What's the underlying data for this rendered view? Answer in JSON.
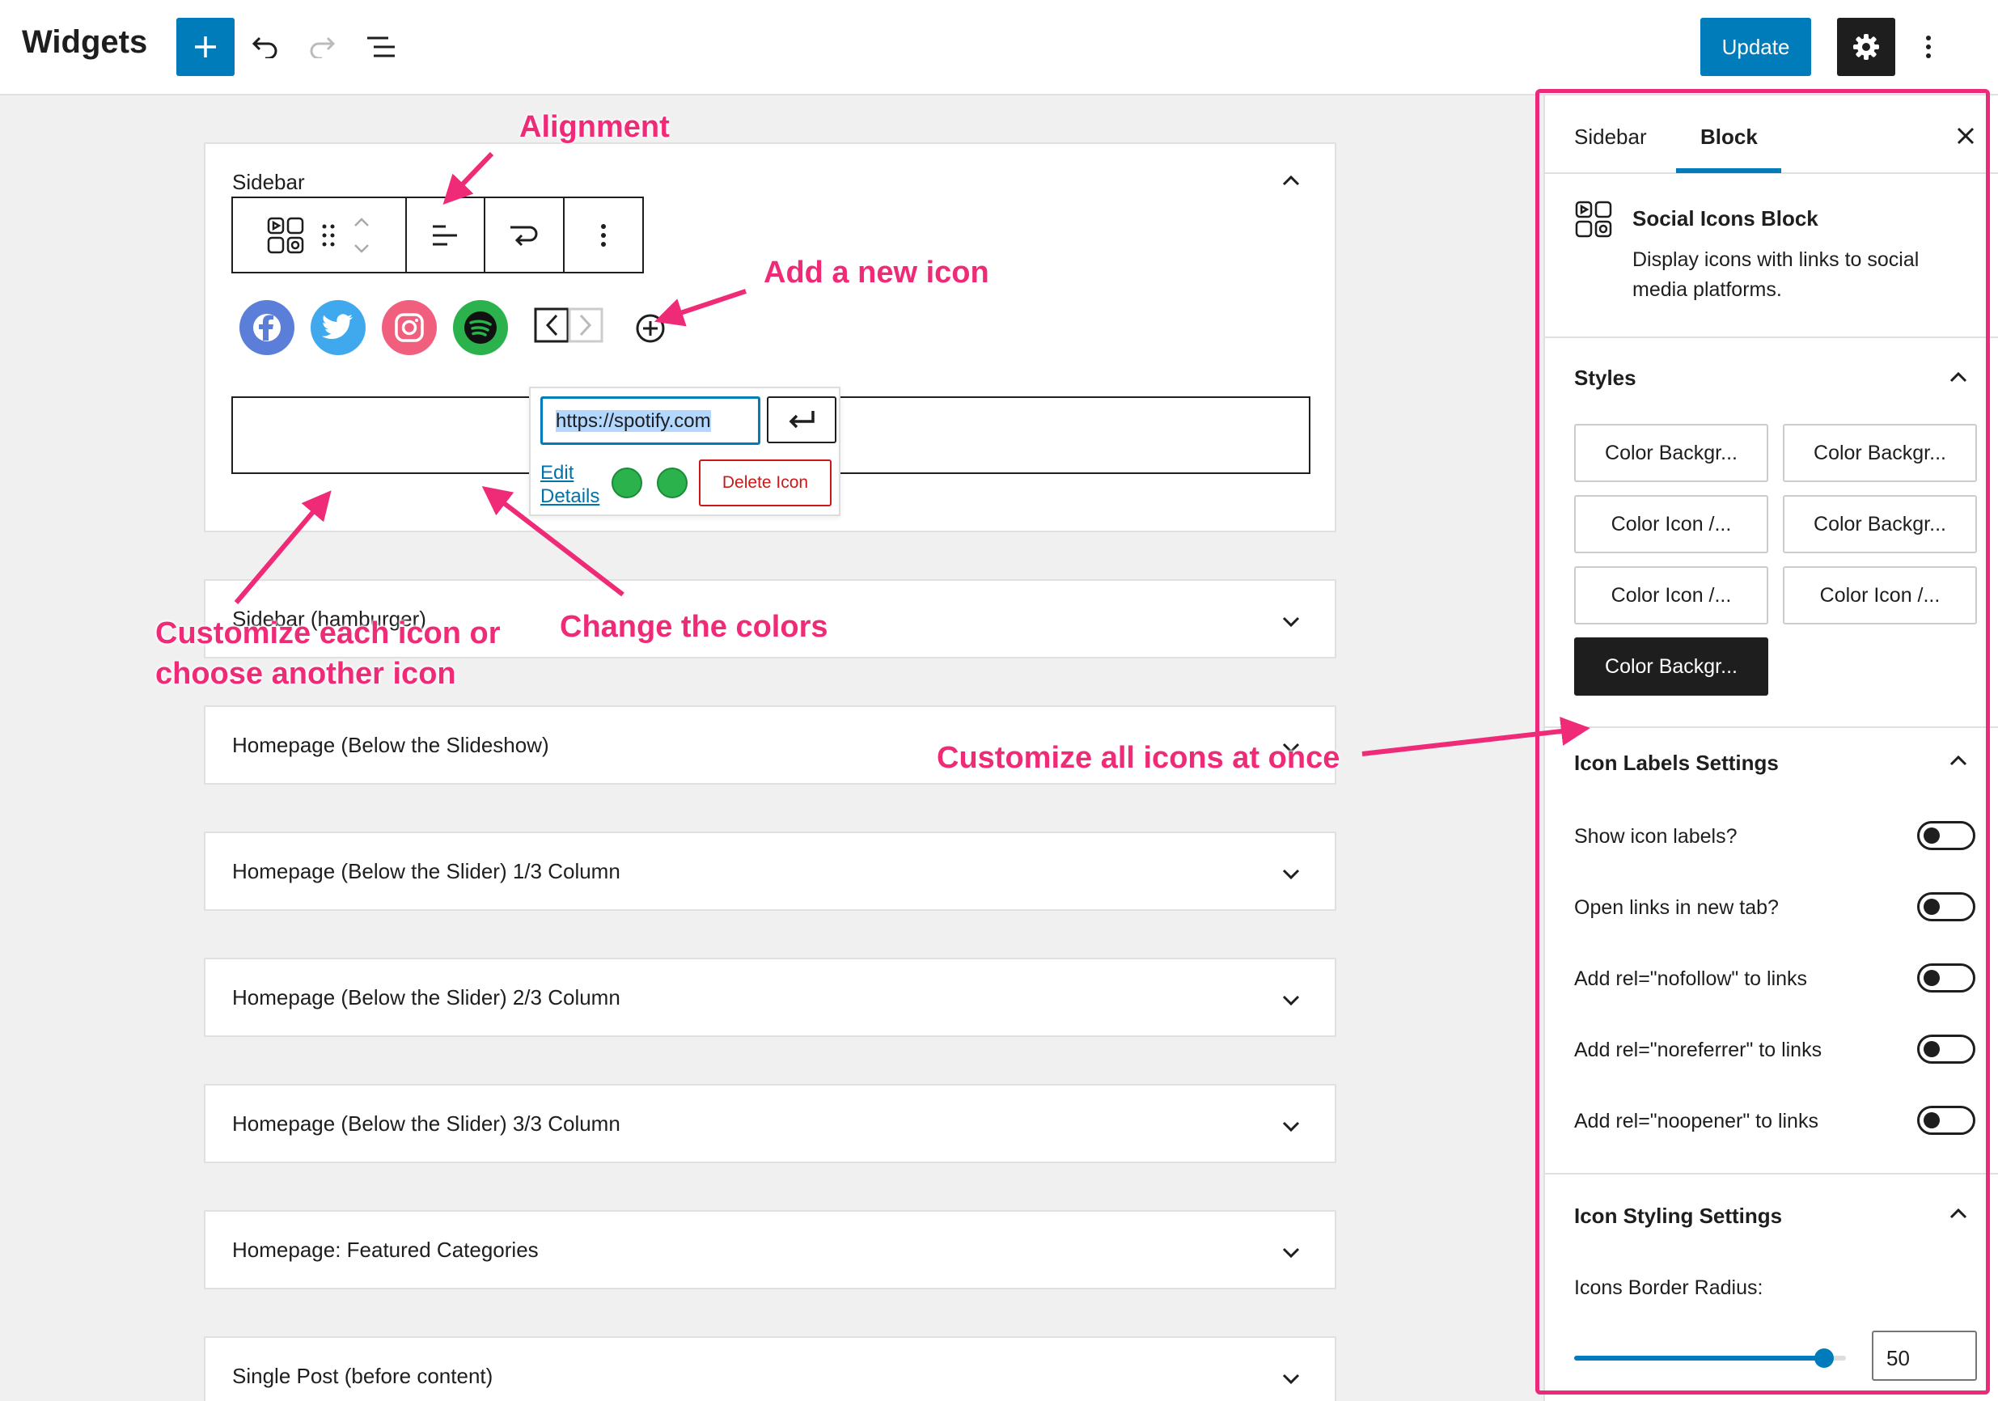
{
  "topbar": {
    "title": "Widgets",
    "update_label": "Update"
  },
  "colors": {
    "accent": "#007cba",
    "annotation": "#ef2b78",
    "facebook": "#5b7fd9",
    "twitter": "#40a8ec",
    "instagram": "#f0607e",
    "spotify": "#2bb24c"
  },
  "sidebar_area": {
    "label": "Sidebar",
    "social_icons": [
      "facebook-icon",
      "twitter-icon",
      "instagram-icon",
      "spotify-icon"
    ],
    "popover": {
      "url": "https://spotify.com",
      "edit_details": "Edit Details",
      "delete_label": "Delete Icon"
    }
  },
  "areas": [
    "Sidebar (hamburger)",
    "Homepage (Below the Slideshow)",
    "Homepage (Below the Slider) 1/3 Column",
    "Homepage (Below the Slider) 2/3 Column",
    "Homepage (Below the Slider) 3/3 Column",
    "Homepage: Featured Categories",
    "Single Post (before content)"
  ],
  "panel": {
    "tabs": [
      "Sidebar",
      "Block"
    ],
    "active_tab": "Block",
    "block_title": "Social Icons Block",
    "block_desc": "Display icons with links to social media platforms.",
    "styles_title": "Styles",
    "styles": [
      "Color Backgr...",
      "Color Backgr...",
      "Color Icon /...",
      "Color Backgr...",
      "Color Icon /...",
      "Color Icon /...",
      "Color Backgr..."
    ],
    "active_style_index": 6,
    "labels_title": "Icon Labels Settings",
    "toggles": [
      {
        "label": "Show icon labels?",
        "on": false
      },
      {
        "label": "Open links in new tab?",
        "on": false
      },
      {
        "label": "Add rel=\"nofollow\" to links",
        "on": false
      },
      {
        "label": "Add rel=\"noreferrer\" to links",
        "on": false
      },
      {
        "label": "Add rel=\"noopener\" to links",
        "on": false
      }
    ],
    "styling_title": "Icon Styling Settings",
    "radius_label": "Icons Border Radius:",
    "radius_value": "50",
    "radius_fraction": 0.92
  },
  "annotations": {
    "alignment": "Alignment",
    "add_icon": "Add a new icon",
    "customize_each_1": "Customize each icon or",
    "customize_each_2": "choose another icon",
    "change_colors": "Change the colors",
    "customize_all": "Customize all icons at once"
  }
}
